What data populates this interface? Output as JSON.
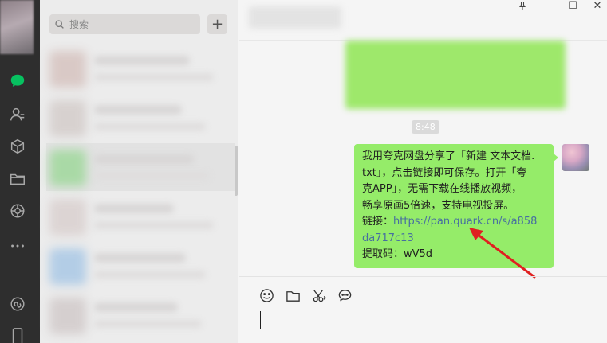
{
  "nav": {
    "items": [
      "chat-icon",
      "contacts-icon",
      "box-icon",
      "folder-icon",
      "moments-icon",
      "more-icon",
      "miniprogram-icon",
      "phone-icon"
    ],
    "active_color": "#07c160"
  },
  "list": {
    "search_placeholder": "搜索",
    "add_label": "+"
  },
  "chat": {
    "time_label": "8:48",
    "message": {
      "line1": "我用夸克网盘分享了「新建 文本文档.",
      "line2": "txt」，点击链接即可保存。打开「夸",
      "line3": "克APP」，无需下载在线播放视频，",
      "line4": "畅享原画5倍速，支持电视投屏。",
      "link_label": "链接：",
      "link_part1": "https://pan.quark.cn/s/a858",
      "link_part2": "da717c13",
      "code_label": "提取码：",
      "code_value": "wV5d"
    },
    "bubble_color": "#95ec69",
    "link_color": "#476fa0",
    "arrow_color": "#e02020"
  },
  "window": {
    "pin": "pin-icon",
    "minimize": "—",
    "maximize": "☐",
    "close": "✕"
  },
  "toolbar": [
    "emoji-icon",
    "file-icon",
    "scissors-icon",
    "chat-bubble-icon"
  ]
}
